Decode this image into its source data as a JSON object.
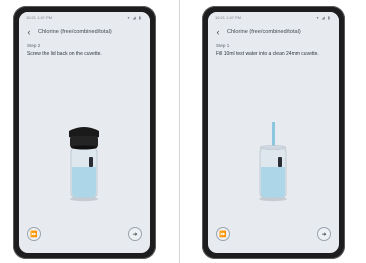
{
  "screens": [
    {
      "status_time": "10:21 1:47 PM",
      "status_icons": "▾ ◢ ▮",
      "title": "Chlorine (free/combined/total)",
      "step": "Step 2",
      "instruction": "Screw the lid back on the cuvette.",
      "skip_icon": "fast-forward-icon",
      "next_icon": "arrow-right-icon",
      "illustration": "cuvette-with-lid"
    },
    {
      "status_time": "10:21 1:47 PM",
      "status_icons": "▾ ◢ ▮",
      "title": "Chlorine (free/combined/total)",
      "step": "Step 1",
      "instruction": "Fill 10ml test water into a clean 24mm cuvette.",
      "skip_icon": "fast-forward-icon",
      "next_icon": "arrow-right-icon",
      "illustration": "cuvette-filling"
    }
  ],
  "colors": {
    "screen_bg": "#e7ebef",
    "phone_frame": "#1d1d1f",
    "water": "#9fd0e6",
    "lid": "#1a1a1a"
  }
}
